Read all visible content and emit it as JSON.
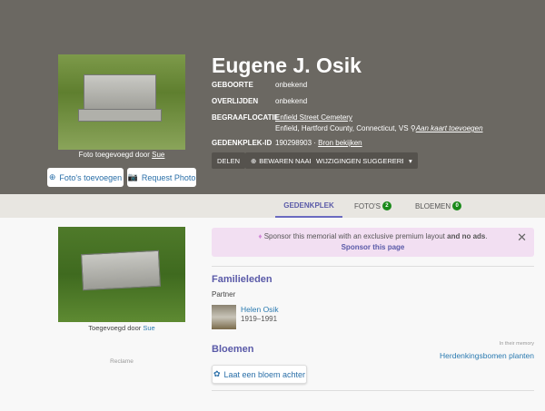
{
  "header": {
    "name": "Eugene J. Osik",
    "photo_caption_prefix": "Foto toegevoegd door",
    "photo_caption_user": "Sue",
    "add_photos": "Foto's toevoegen",
    "request_photo": "Request Photo",
    "rows": {
      "birth_label": "GEBOORTE",
      "birth": "onbekend",
      "death_label": "OVERLIJDEN",
      "death": "onbekend",
      "burial_label": "BEGRAAFLOCATIE",
      "cemetery": "Enfield Street Cemetery",
      "location": "Enfield, Hartford County, Connecticut, VS",
      "map_link": "Aan kaart toevoegen",
      "id_label": "GEDENKPLEK-ID",
      "id": "190298903",
      "source_link": "Bron bekijken"
    },
    "actions": {
      "share": "DELEN",
      "save": "BEWAREN NAAR",
      "suggest": "WIJZIGINGEN SUGGEREREN",
      "more": "▾"
    }
  },
  "tabs": [
    {
      "label": "GEDENKPLEK"
    },
    {
      "label": "FOTO'S",
      "count": "2"
    },
    {
      "label": "BLOEMEN",
      "count": "0"
    }
  ],
  "left": {
    "caption_prefix": "Toegevoegd door",
    "caption_user": "Sue",
    "ad": "Reclame"
  },
  "sponsor": {
    "text": "Sponsor this memorial with an exclusive premium layout",
    "bold": "and no ads",
    "period": ".",
    "link": "Sponsor this page"
  },
  "family": {
    "title": "Familieleden",
    "relation": "Partner",
    "member_name": "Helen Osik",
    "member_dates": "1919–1991"
  },
  "flowers": {
    "title": "Bloemen",
    "memory_small": "In their memory",
    "trees_link": "Herdenkingsbomen planten",
    "leave_flower": "Laat een bloem achter"
  }
}
